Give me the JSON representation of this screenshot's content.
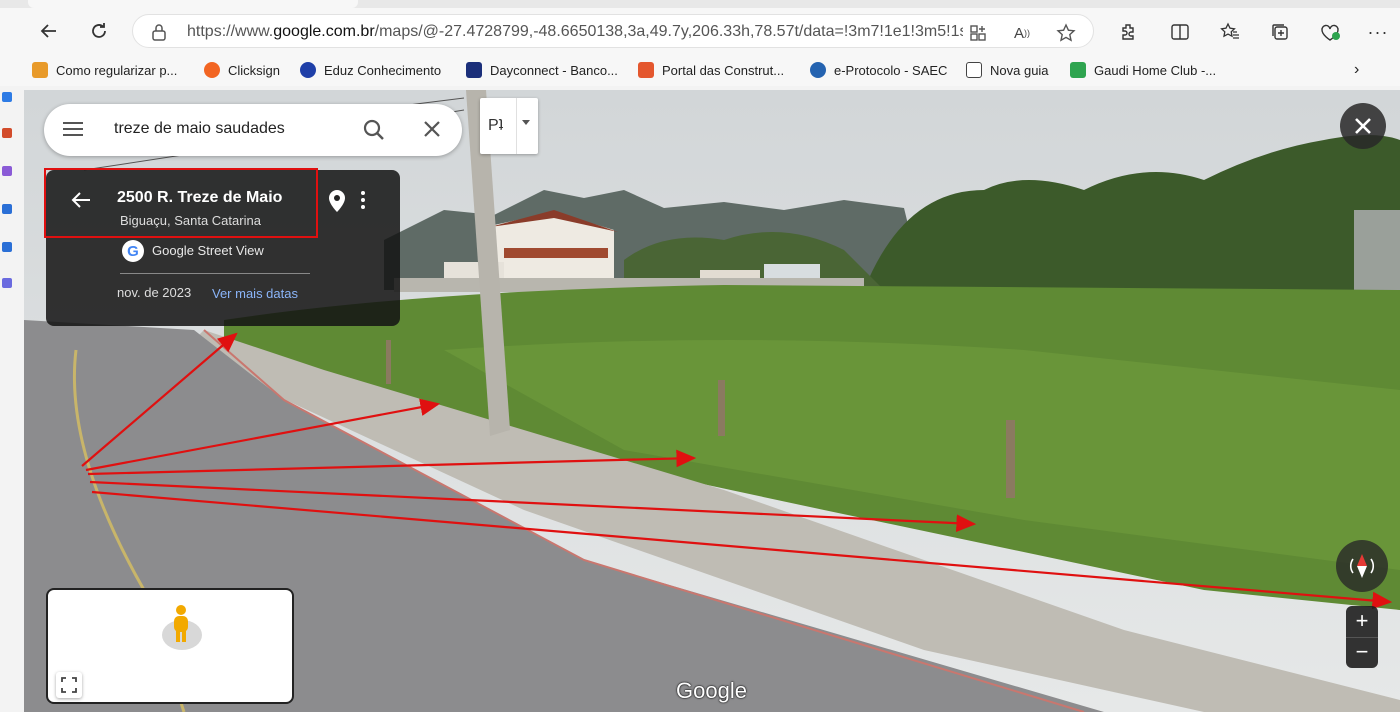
{
  "browser": {
    "url_prefix": "https://www.",
    "url_domain": "google.com.br",
    "url_rest": "/maps/@-27.4728799,-48.6650138,3a,49.7y,206.33h,78.57t/data=!3m7!1e1!3m5!1s..."
  },
  "bookmarks": [
    {
      "label": "Como regularizar p...",
      "color": "#e89a2a"
    },
    {
      "label": "Clicksign",
      "color": "#f26522"
    },
    {
      "label": "Eduz Conhecimento",
      "color": "#1f3fa8"
    },
    {
      "label": "Dayconnect - Banco...",
      "color": "#1b2f7a"
    },
    {
      "label": "Portal das Construt...",
      "color": "#e4572e"
    },
    {
      "label": "e-Protocolo - SAEC",
      "color": "#2463b0"
    },
    {
      "label": "Nova guia",
      "color": "#444444"
    },
    {
      "label": "Gaudi Home Club -...",
      "color": "#2ea44f"
    }
  ],
  "search": {
    "query": "treze de maio saudades"
  },
  "pegman_selector": {
    "label": "Pʇ"
  },
  "info_card": {
    "address": "2500 R. Treze de Maio",
    "city": "Biguaçu, Santa Catarina",
    "source": "Google Street View",
    "date": "nov. de 2023",
    "more_dates": "Ver mais datas"
  },
  "map_controls": {
    "zoom_in": "+",
    "zoom_out": "−"
  },
  "logo": "Google"
}
